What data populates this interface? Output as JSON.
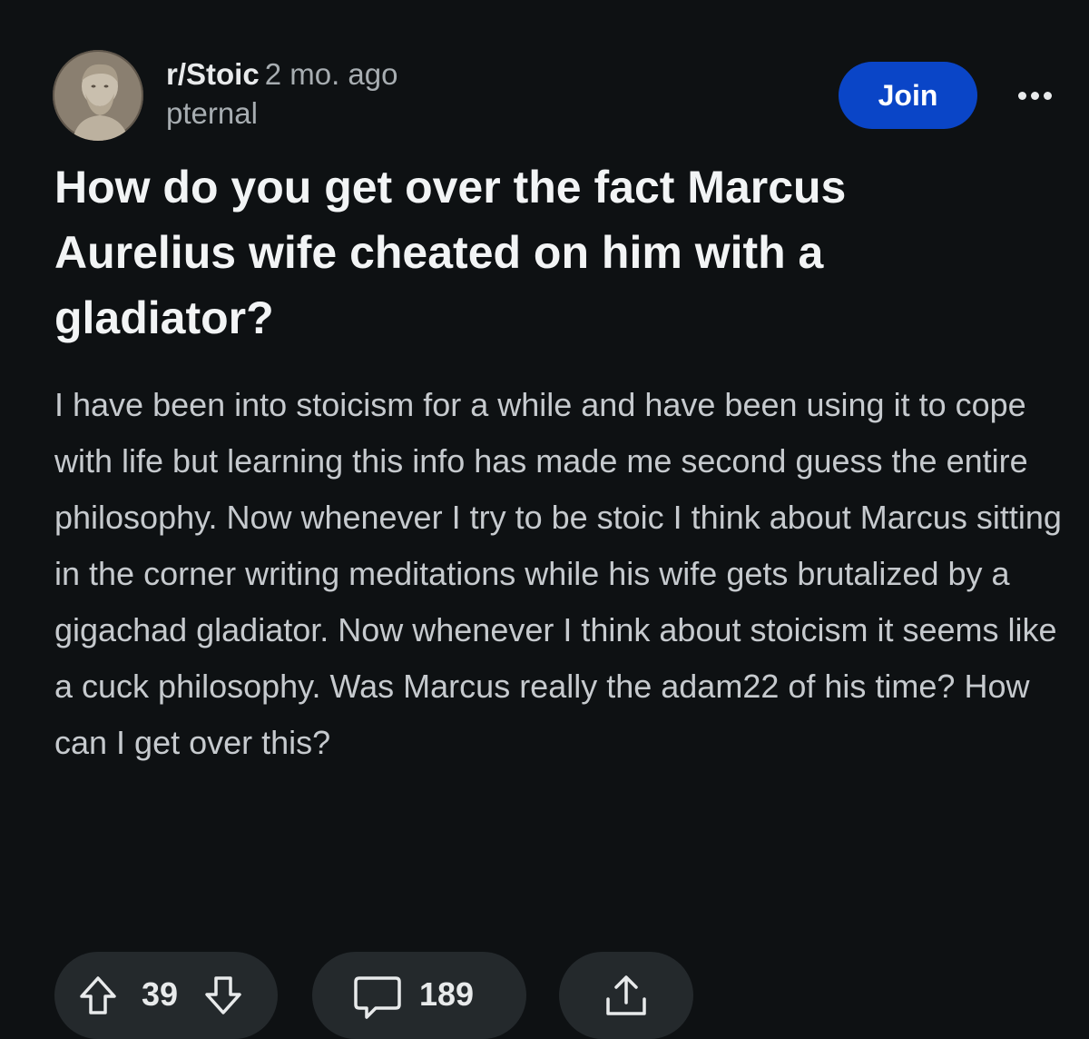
{
  "post": {
    "subreddit": "r/Stoic",
    "time_ago": "2 mo. ago",
    "author": "pternal",
    "join_label": "Join",
    "title": "How do you get over the fact Marcus Aurelius wife cheated on him with a gladiator?",
    "body": "I have been into stoicism for a while and have been using it to cope with life but learning this info has made me second guess the entire philosophy. Now whenever I try to be stoic I think about Marcus sitting in the corner writing meditations while his wife gets brutalized by a gigachad gladiator. Now whenever I think about stoicism it seems like a cuck philosophy. Was Marcus really the adam22 of his time? How can I get over this?"
  },
  "actions": {
    "upvote_count": "39",
    "comment_count": "189"
  },
  "icons": {
    "avatar": "marcus-aurelius-bust-avatar",
    "more": "more-options-icon",
    "upvote": "upvote-arrow-icon",
    "downvote": "downvote-arrow-icon",
    "comment": "comment-bubble-icon",
    "share": "share-icon"
  },
  "colors": {
    "background": "#0e1113",
    "join_button": "#0a45c7",
    "pill": "#24292c",
    "title_text": "#f2f4f5",
    "body_text": "#c6cace",
    "meta_text": "#a7adb1"
  }
}
